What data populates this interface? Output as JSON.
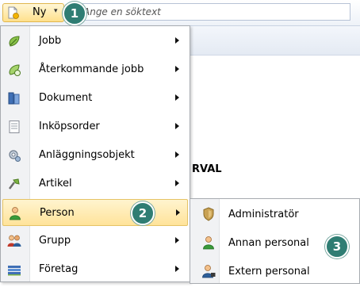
{
  "toolbar": {
    "new_label": "Ny",
    "caret": "▾",
    "search_placeholder": "Ange en söktext"
  },
  "callouts": [
    "1",
    "2",
    "3"
  ],
  "background": {
    "partial_label": "RVAL"
  },
  "menu": {
    "items": [
      {
        "label": "Jobb",
        "icon": "job-icon"
      },
      {
        "label": "Återkommande jobb",
        "icon": "recurring-job-icon"
      },
      {
        "label": "Dokument",
        "icon": "document-icon"
      },
      {
        "label": "Inköpsorder",
        "icon": "purchase-order-icon"
      },
      {
        "label": "Anläggningsobjekt",
        "icon": "facility-object-icon"
      },
      {
        "label": "Artikel",
        "icon": "article-icon"
      },
      {
        "label": "Person",
        "icon": "person-icon",
        "highlighted": true
      },
      {
        "label": "Grupp",
        "icon": "group-icon"
      },
      {
        "label": "Företag",
        "icon": "company-icon"
      }
    ]
  },
  "submenu": {
    "items": [
      {
        "label": "Administratör",
        "icon": "administrator-icon"
      },
      {
        "label": "Annan personal",
        "icon": "other-staff-icon"
      },
      {
        "label": "Extern personal",
        "icon": "external-staff-icon"
      }
    ]
  },
  "colors": {
    "highlight": "#ffe39a",
    "callout": "#2f7d73",
    "gutter": "#f1f2f4"
  }
}
